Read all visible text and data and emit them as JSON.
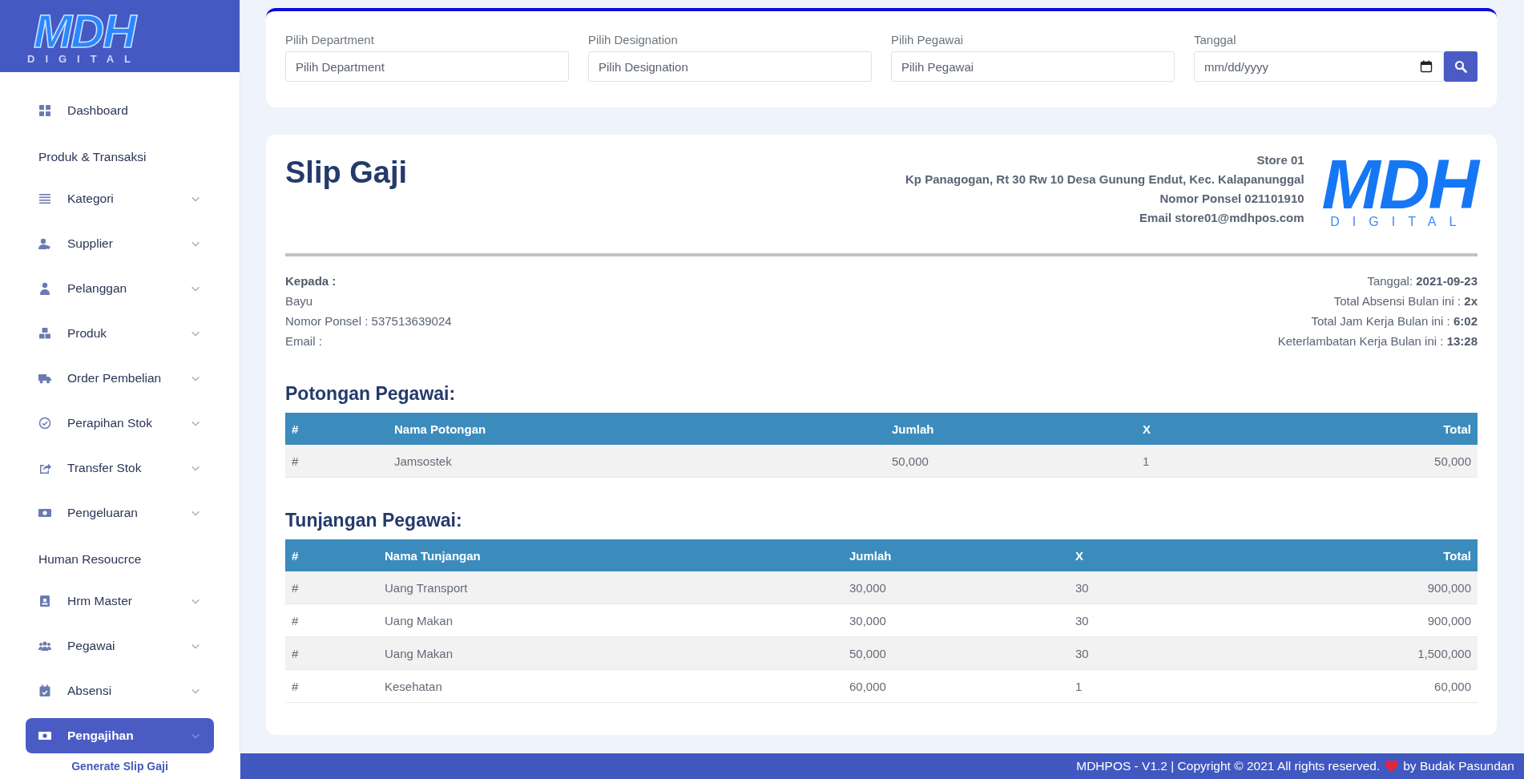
{
  "sidebar": {
    "logo": {
      "title": "MDH",
      "subtitle": "DIGITAL"
    },
    "items": [
      {
        "kind": "link",
        "label": "Dashboard",
        "selected": false
      },
      {
        "kind": "section",
        "label": "Produk & Transaksi"
      },
      {
        "kind": "menu",
        "label": "Kategori",
        "selected": false
      },
      {
        "kind": "menu",
        "label": "Supplier",
        "selected": false
      },
      {
        "kind": "menu",
        "label": "Pelanggan",
        "selected": false
      },
      {
        "kind": "menu",
        "label": "Produk",
        "selected": false
      },
      {
        "kind": "menu",
        "label": "Order Pembelian",
        "selected": false
      },
      {
        "kind": "menu",
        "label": "Perapihan Stok",
        "selected": false
      },
      {
        "kind": "menu",
        "label": "Transfer Stok",
        "selected": false
      },
      {
        "kind": "menu",
        "label": "Pengeluaran",
        "selected": false
      },
      {
        "kind": "section",
        "label": "Human Resoucrce"
      },
      {
        "kind": "menu",
        "label": "Hrm Master",
        "selected": false
      },
      {
        "kind": "menu",
        "label": "Pegawai",
        "selected": false
      },
      {
        "kind": "menu",
        "label": "Absensi",
        "selected": false
      },
      {
        "kind": "menu",
        "label": "Pengajihan",
        "selected": true,
        "expanded": true,
        "children": [
          {
            "label": "Generate Slip Gaji"
          }
        ]
      }
    ]
  },
  "filters": [
    {
      "kind": "select",
      "label": "Pilih Department",
      "placeholder": "Pilih Department"
    },
    {
      "kind": "select",
      "label": "Pilih Designation",
      "placeholder": "Pilih Designation"
    },
    {
      "kind": "select",
      "label": "Pilih Pegawai",
      "placeholder": "Pilih Pegawai"
    },
    {
      "kind": "date",
      "label": "Tanggal",
      "placeholder": "mm/dd/yyyy"
    }
  ],
  "slip": {
    "title": "Slip Gaji",
    "store": [
      "Store 01",
      "Kp Panagogan, Rt 30 Rw 10 Desa Gunung Endut, Kec. Kalapanunggal",
      "Nomor Ponsel 021101910",
      "Email store01@mdhpos.com"
    ],
    "logo": {
      "title": "MDH",
      "subtitle": "DIGITAL"
    },
    "recipient": [
      "**Kepada :**",
      "Bayu",
      "Nomor Ponsel : 537513639024",
      "Email :"
    ],
    "summary": [
      "Tanggal: **2021-09-23**",
      "Total Absensi Bulan ini : **2x**",
      "Total Jam Kerja Bulan ini : **6:02**",
      "Keterlambatan Kerja Bulan ini : **13:28**"
    ],
    "tables": [
      {
        "title": "Potongan Pegawai:",
        "columns": [
          "#",
          "Nama Potongan",
          "Jumlah",
          "X",
          "Total"
        ],
        "rows": [
          [
            "#",
            "Jamsostek",
            "50,000",
            "1",
            "50,000"
          ]
        ]
      },
      {
        "title": "Tunjangan Pegawai:",
        "columns": [
          "#",
          "Nama Tunjangan",
          "Jumlah",
          "X",
          "Total"
        ],
        "rows": [
          [
            "#",
            "Uang Transport",
            "30,000",
            "30",
            "900,000"
          ],
          [
            "#",
            "Uang Makan",
            "30,000",
            "30",
            "900,000"
          ],
          [
            "#",
            "Uang Makan",
            "50,000",
            "30",
            "1,500,000"
          ],
          [
            "#",
            "Kesehatan",
            "60,000",
            "1",
            "60,000"
          ]
        ]
      }
    ]
  },
  "footer": {
    "text": "MDHPOS - V1.2 | Copyright © 2021 All rights reserved.",
    "credit": "by Budak Pasundan"
  }
}
